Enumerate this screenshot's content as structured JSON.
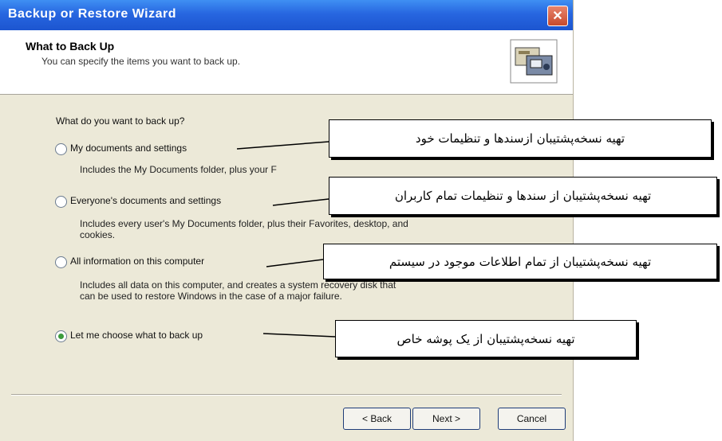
{
  "window": {
    "title": "Backup or Restore Wizard",
    "close_glyph": "✕"
  },
  "header": {
    "title": "What to Back Up",
    "subtitle": "You can specify the items you want to back up."
  },
  "question": "What do you want to back up?",
  "options": [
    {
      "label": "My documents and settings",
      "desc_lines": [
        "Includes the My Documents folder, plus your F"
      ],
      "selected": false
    },
    {
      "label": "Everyone's documents and settings",
      "desc_lines": [
        "Includes every user's My Documents folder, plus their Favorites, desktop, and",
        "cookies."
      ],
      "selected": false
    },
    {
      "label": "All information on this computer",
      "desc_lines": [
        "Includes all data on this computer, and creates a system recovery disk that",
        "can be used to restore Windows in the case of a major failure."
      ],
      "selected": false
    },
    {
      "label": "Let me choose what to back up",
      "desc_lines": [],
      "selected": true
    }
  ],
  "buttons": {
    "back": "< Back",
    "next": "Next >",
    "cancel": "Cancel"
  },
  "callouts": [
    "تهیه نسخه‌پشتیبان ازسندها و تنظیمات خود",
    "تهیه نسخه‌پشتیبان از سندها و تنظیمات تمام کاربران",
    "تهیه نسخه‌پشتیبان از تمام اطلاعات موجود در سیستم",
    "تهیه نسخه‌پشتیبان از یک پوشه خاص"
  ],
  "icons": {
    "close": "close-icon",
    "header": "backup-wizard-icon"
  }
}
